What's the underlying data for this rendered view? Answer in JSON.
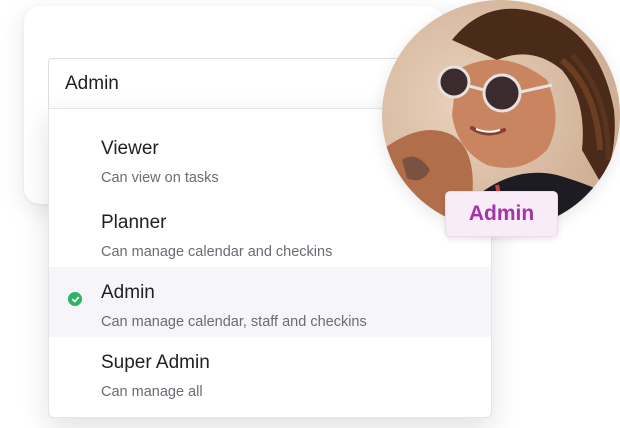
{
  "select": {
    "value": "Admin"
  },
  "menu": {
    "options": [
      {
        "title": "Viewer",
        "description": "Can view on tasks",
        "selected": false
      },
      {
        "title": "Planner",
        "description": "Can manage calendar and checkins",
        "selected": false
      },
      {
        "title": "Admin",
        "description": "Can manage calendar, staff and checkins",
        "selected": true
      },
      {
        "title": "Super Admin",
        "description": "Can manage all",
        "selected": false
      }
    ],
    "selected_icon": "check-circle-icon"
  },
  "profile": {
    "role_badge": "Admin"
  },
  "colors": {
    "check": "#2fb268",
    "badge_text": "#a633a8",
    "badge_bg": "#f7ecf7",
    "selected_row_bg": "#f6f6f8"
  }
}
